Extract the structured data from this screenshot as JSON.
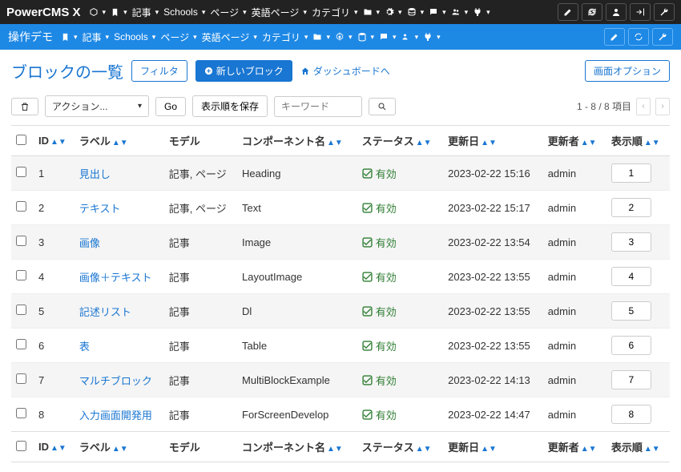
{
  "brand": "PowerCMS X",
  "topnav": [
    "記事",
    "Schools",
    "ページ",
    "英語ページ",
    "カテゴリ"
  ],
  "scope": "操作デモ",
  "page_title": "ブロックの一覧",
  "buttons": {
    "filter": "フィルタ",
    "new_block": "新しいブロック",
    "dashboard": "ダッシュボードへ",
    "options": "画面オプション",
    "go": "Go",
    "save_order": "表示順を保存"
  },
  "action_placeholder": "アクション...",
  "keyword_placeholder": "キーワード",
  "pager": "1 - 8 / 8 項目",
  "columns": {
    "id": "ID",
    "label": "ラベル",
    "model": "モデル",
    "component": "コンポーネント名",
    "status": "ステータス",
    "updated": "更新日",
    "updater": "更新者",
    "order": "表示順"
  },
  "status_enabled": "有効",
  "rows": [
    {
      "id": "1",
      "label": "見出し",
      "model": "記事, ページ",
      "component": "Heading",
      "updated": "2023-02-22 15:16",
      "updater": "admin",
      "order": "1"
    },
    {
      "id": "2",
      "label": "テキスト",
      "model": "記事, ページ",
      "component": "Text",
      "updated": "2023-02-22 15:17",
      "updater": "admin",
      "order": "2"
    },
    {
      "id": "3",
      "label": "画像",
      "model": "記事",
      "component": "Image",
      "updated": "2023-02-22 13:54",
      "updater": "admin",
      "order": "3"
    },
    {
      "id": "4",
      "label": "画像＋テキスト",
      "model": "記事",
      "component": "LayoutImage",
      "updated": "2023-02-22 13:55",
      "updater": "admin",
      "order": "4"
    },
    {
      "id": "5",
      "label": "記述リスト",
      "model": "記事",
      "component": "Dl",
      "updated": "2023-02-22 13:55",
      "updater": "admin",
      "order": "5"
    },
    {
      "id": "6",
      "label": "表",
      "model": "記事",
      "component": "Table",
      "updated": "2023-02-22 13:55",
      "updater": "admin",
      "order": "6"
    },
    {
      "id": "7",
      "label": "マルチブロック",
      "model": "記事",
      "component": "MultiBlockExample",
      "updated": "2023-02-22 14:13",
      "updater": "admin",
      "order": "7"
    },
    {
      "id": "8",
      "label": "入力画面開発用",
      "model": "記事",
      "component": "ForScreenDevelop",
      "updated": "2023-02-22 14:47",
      "updater": "admin",
      "order": "8"
    }
  ]
}
